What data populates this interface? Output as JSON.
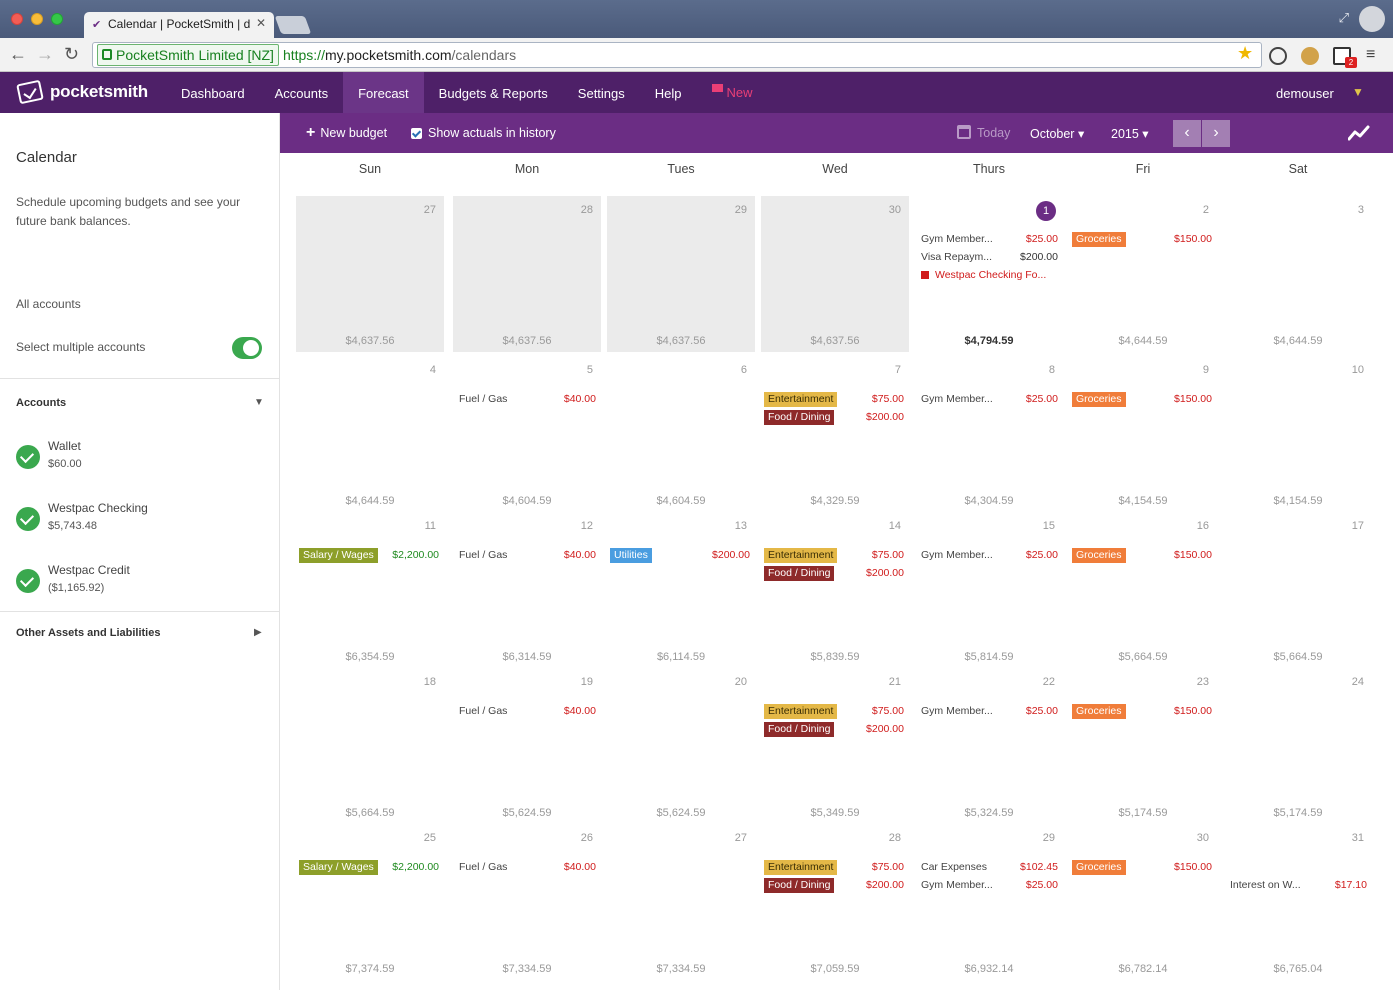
{
  "browser": {
    "tab_title": "Calendar | PocketSmith | d",
    "ev_name": "PocketSmith Limited [NZ]",
    "url_scheme": "https://",
    "url_host": "my.pocketsmith.com",
    "url_path": "/calendars",
    "ext_badge": "2"
  },
  "app": {
    "brand": "pocketsmith",
    "nav": [
      "Dashboard",
      "Accounts",
      "Forecast",
      "Budgets & Reports",
      "Settings",
      "Help"
    ],
    "nav_new": "New",
    "user": "demouser"
  },
  "sidebar": {
    "title": "Calendar",
    "description": "Schedule upcoming budgets and see your future bank balances.",
    "all_accounts": "All accounts",
    "select_multiple": "Select multiple accounts",
    "accounts_heading": "Accounts",
    "accounts": [
      {
        "name": "Wallet",
        "balance": "$60.00"
      },
      {
        "name": "Westpac Checking",
        "balance": "$5,743.48"
      },
      {
        "name": "Westpac Credit",
        "balance": "($1,165.92)"
      }
    ],
    "other_heading": "Other Assets and Liabilities"
  },
  "toolbar": {
    "new_budget": "New budget",
    "show_actuals": "Show actuals in history",
    "today": "Today",
    "month": "October",
    "year": "2015"
  },
  "calendar": {
    "days": [
      "Sun",
      "Mon",
      "Tues",
      "Wed",
      "Thurs",
      "Fri",
      "Sat"
    ],
    "weeks": [
      [
        {
          "date": "27",
          "past": true,
          "balance": "$4,637.56",
          "events": []
        },
        {
          "date": "28",
          "past": true,
          "balance": "$4,637.56",
          "events": []
        },
        {
          "date": "29",
          "past": true,
          "balance": "$4,637.56",
          "events": []
        },
        {
          "date": "30",
          "past": true,
          "balance": "$4,637.56",
          "events": []
        },
        {
          "date": "1",
          "today": true,
          "balance": "$4,794.59",
          "events": [
            {
              "label": "Gym Member...",
              "amount": "$25.00",
              "kind": "neg"
            },
            {
              "label": "Visa Repaym...",
              "amount": "$200.00",
              "kind": "dark"
            },
            {
              "label": "Westpac Checking Fo...",
              "amount": "",
              "kind": "flag"
            }
          ]
        },
        {
          "date": "2",
          "balance": "$4,644.59",
          "events": [
            {
              "label": "Groceries",
              "amount": "$150.00",
              "kind": "neg",
              "tag": "groc"
            }
          ]
        },
        {
          "date": "3",
          "balance": "$4,644.59",
          "events": []
        }
      ],
      [
        {
          "date": "4",
          "balance": "$4,644.59",
          "events": []
        },
        {
          "date": "5",
          "balance": "$4,604.59",
          "events": [
            {
              "label": "Fuel / Gas",
              "amount": "$40.00",
              "kind": "neg"
            }
          ]
        },
        {
          "date": "6",
          "balance": "$4,604.59",
          "events": []
        },
        {
          "date": "7",
          "balance": "$4,329.59",
          "events": [
            {
              "label": "Entertainment",
              "amount": "$75.00",
              "kind": "neg",
              "tag": "ent"
            },
            {
              "label": "Food / Dining",
              "amount": "$200.00",
              "kind": "neg",
              "tag": "food"
            }
          ]
        },
        {
          "date": "8",
          "balance": "$4,304.59",
          "events": [
            {
              "label": "Gym Member...",
              "amount": "$25.00",
              "kind": "neg"
            }
          ]
        },
        {
          "date": "9",
          "balance": "$4,154.59",
          "events": [
            {
              "label": "Groceries",
              "amount": "$150.00",
              "kind": "neg",
              "tag": "groc"
            }
          ]
        },
        {
          "date": "10",
          "balance": "$4,154.59",
          "events": []
        }
      ],
      [
        {
          "date": "11",
          "balance": "$6,354.59",
          "events": [
            {
              "label": "Salary / Wages",
              "amount": "$2,200.00",
              "kind": "pos",
              "tag": "sal"
            }
          ]
        },
        {
          "date": "12",
          "balance": "$6,314.59",
          "events": [
            {
              "label": "Fuel / Gas",
              "amount": "$40.00",
              "kind": "neg"
            }
          ]
        },
        {
          "date": "13",
          "balance": "$6,114.59",
          "events": [
            {
              "label": "Utilities",
              "amount": "$200.00",
              "kind": "neg",
              "tag": "util"
            }
          ]
        },
        {
          "date": "14",
          "balance": "$5,839.59",
          "events": [
            {
              "label": "Entertainment",
              "amount": "$75.00",
              "kind": "neg",
              "tag": "ent"
            },
            {
              "label": "Food / Dining",
              "amount": "$200.00",
              "kind": "neg",
              "tag": "food"
            }
          ]
        },
        {
          "date": "15",
          "balance": "$5,814.59",
          "events": [
            {
              "label": "Gym Member...",
              "amount": "$25.00",
              "kind": "neg"
            }
          ]
        },
        {
          "date": "16",
          "balance": "$5,664.59",
          "events": [
            {
              "label": "Groceries",
              "amount": "$150.00",
              "kind": "neg",
              "tag": "groc"
            }
          ]
        },
        {
          "date": "17",
          "balance": "$5,664.59",
          "events": []
        }
      ],
      [
        {
          "date": "18",
          "balance": "$5,664.59",
          "events": []
        },
        {
          "date": "19",
          "balance": "$5,624.59",
          "events": [
            {
              "label": "Fuel / Gas",
              "amount": "$40.00",
              "kind": "neg"
            }
          ]
        },
        {
          "date": "20",
          "balance": "$5,624.59",
          "events": []
        },
        {
          "date": "21",
          "balance": "$5,349.59",
          "events": [
            {
              "label": "Entertainment",
              "amount": "$75.00",
              "kind": "neg",
              "tag": "ent"
            },
            {
              "label": "Food / Dining",
              "amount": "$200.00",
              "kind": "neg",
              "tag": "food"
            }
          ]
        },
        {
          "date": "22",
          "balance": "$5,324.59",
          "events": [
            {
              "label": "Gym Member...",
              "amount": "$25.00",
              "kind": "neg"
            }
          ]
        },
        {
          "date": "23",
          "balance": "$5,174.59",
          "events": [
            {
              "label": "Groceries",
              "amount": "$150.00",
              "kind": "neg",
              "tag": "groc"
            }
          ]
        },
        {
          "date": "24",
          "balance": "$5,174.59",
          "events": []
        }
      ],
      [
        {
          "date": "25",
          "balance": "$7,374.59",
          "events": [
            {
              "label": "Salary / Wages",
              "amount": "$2,200.00",
              "kind": "pos",
              "tag": "sal"
            }
          ]
        },
        {
          "date": "26",
          "balance": "$7,334.59",
          "events": [
            {
              "label": "Fuel / Gas",
              "amount": "$40.00",
              "kind": "neg"
            }
          ]
        },
        {
          "date": "27",
          "balance": "$7,334.59",
          "events": []
        },
        {
          "date": "28",
          "balance": "$7,059.59",
          "events": [
            {
              "label": "Entertainment",
              "amount": "$75.00",
              "kind": "neg",
              "tag": "ent"
            },
            {
              "label": "Food / Dining",
              "amount": "$200.00",
              "kind": "neg",
              "tag": "food"
            }
          ]
        },
        {
          "date": "29",
          "balance": "$6,932.14",
          "events": [
            {
              "label": "Car Expenses",
              "amount": "$102.45",
              "kind": "neg"
            },
            {
              "label": "Gym Member...",
              "amount": "$25.00",
              "kind": "neg"
            }
          ]
        },
        {
          "date": "30",
          "balance": "$6,782.14",
          "events": [
            {
              "label": "Groceries",
              "amount": "$150.00",
              "kind": "neg",
              "tag": "groc"
            }
          ]
        },
        {
          "date": "31",
          "balance": "$6,765.04",
          "events": [
            {
              "label": "",
              "amount": "",
              "kind": "spacer"
            },
            {
              "label": "Interest on W...",
              "amount": "$17.10",
              "kind": "neg"
            }
          ]
        }
      ]
    ]
  }
}
